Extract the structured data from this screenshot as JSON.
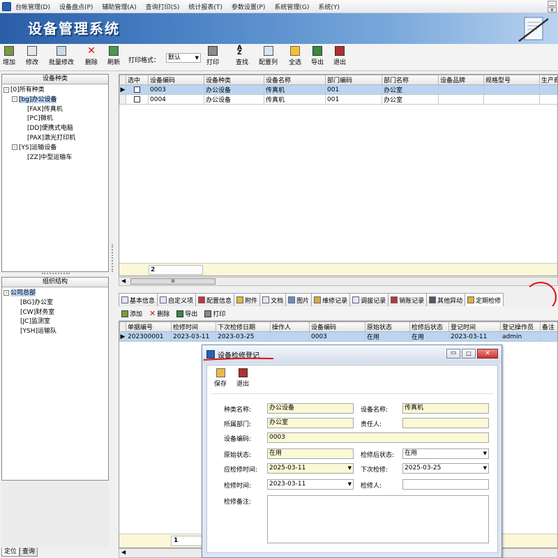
{
  "menubar": {
    "items": [
      "台帐管理(D)",
      "设备盘点(P)",
      "辅助管理(A)",
      "查询打印(S)",
      "统计报表(T)",
      "参数设置(P)",
      "系统管理(G)",
      "系统(Y)"
    ],
    "win_min": "_",
    "win_close": "x"
  },
  "banner": {
    "title": "设备管理系统"
  },
  "toolbar": {
    "add": "增加",
    "edit": "修改",
    "batch_edit": "批量修改",
    "delete": "删除",
    "refresh": "刷新",
    "print_format_label": "打印格式：",
    "print_format_value": "默认",
    "print": "打印",
    "find": "查找",
    "config_cols": "配置列",
    "select_all": "全选",
    "export": "导出",
    "exit": "退出"
  },
  "category_panel": {
    "title": "设备种类",
    "tree": [
      {
        "label": "[0]所有种类",
        "level": 0,
        "toggle": "-"
      },
      {
        "label": "[bg]办公设备",
        "level": 1,
        "toggle": "-",
        "selected": true
      },
      {
        "label": "[FAX]传真机",
        "level": 2
      },
      {
        "label": "[PC]微机",
        "level": 2
      },
      {
        "label": "[DD]便携式电脑",
        "level": 2
      },
      {
        "label": "[PAX]激光打印机",
        "level": 2
      },
      {
        "label": "[YS]运输设备",
        "level": 1,
        "toggle": "-"
      },
      {
        "label": "[ZZ]中型运输车",
        "level": 2
      }
    ]
  },
  "org_panel": {
    "title": "组织结构",
    "tree": [
      {
        "label": "公司总部",
        "level": 0,
        "toggle": "-",
        "selected": true
      },
      {
        "label": "[BG]办公室",
        "level": 1
      },
      {
        "label": "[CW]财务室",
        "level": 1
      },
      {
        "label": "[JC]监测室",
        "level": 1
      },
      {
        "label": "[YSH]运输队",
        "level": 1
      }
    ]
  },
  "left_tabs": {
    "locate": "定位",
    "query": "查询"
  },
  "main_grid": {
    "columns": [
      "选中",
      "设备编码",
      "设备种类",
      "设备名称",
      "部门编码",
      "部门名称",
      "设备品牌",
      "规格型号",
      "生产商"
    ],
    "rows": [
      {
        "code": "0003",
        "category": "办公设备",
        "name": "传真机",
        "dept_code": "001",
        "dept_name": "办公室",
        "brand": "",
        "model": "",
        "maker": ""
      },
      {
        "code": "0004",
        "category": "办公设备",
        "name": "传真机",
        "dept_code": "001",
        "dept_name": "办公室",
        "brand": "",
        "model": "",
        "maker": ""
      }
    ],
    "count": "2",
    "hscroll_thumb": "III"
  },
  "detail_tabs": [
    "基本信息",
    "自定义项",
    "配置信息",
    "附件",
    "文档",
    "图片",
    "维修记录",
    "调拔记录",
    "销账记录",
    "其他异动",
    "定期检修"
  ],
  "sub_toolbar": {
    "add": "添加",
    "delete": "删除",
    "export": "导出",
    "print": "打印"
  },
  "sub_grid": {
    "columns": [
      "单据编号",
      "检修时间",
      "下次检修日期",
      "操作人",
      "设备编码",
      "原始状态",
      "检修后状态",
      "登记时间",
      "登记操作员",
      "备注"
    ],
    "rows": [
      {
        "doc_no": "202300001",
        "date": "2023-03-11",
        "next": "2023-03-25",
        "operator": "",
        "code": "0003",
        "orig": "在用",
        "after": "在用",
        "reg_time": "2023-03-11",
        "reg_user": "admin",
        "remark": ""
      }
    ],
    "count": "1"
  },
  "dialog": {
    "title": "设备检修登记",
    "save": "保存",
    "exit": "退出",
    "labels": {
      "category": "种类名称:",
      "device_name": "设备名称:",
      "dept": "所属部门:",
      "owner": "责任人:",
      "code": "设备编码:",
      "orig_status": "原始状态:",
      "after_status": "检修后状态:",
      "due_time": "应检修时间:",
      "next": "下次检修:",
      "check_time": "检修时间:",
      "checker": "检修人:",
      "remark": "检修备注:"
    },
    "values": {
      "category": "办公设备",
      "device_name": "传真机",
      "dept": "办公室",
      "owner": "",
      "code": "0003",
      "orig_status": "在用",
      "after_status": "在用",
      "due_time": "2025-03-11",
      "next": "2025-03-25",
      "check_time": "2023-03-11",
      "checker": "",
      "remark": ""
    }
  },
  "colors": {
    "banner": "#2a5ea7",
    "selection": "#b9d5f3",
    "annotation": "#e01010",
    "readonly_field": "#fbf8d6"
  }
}
